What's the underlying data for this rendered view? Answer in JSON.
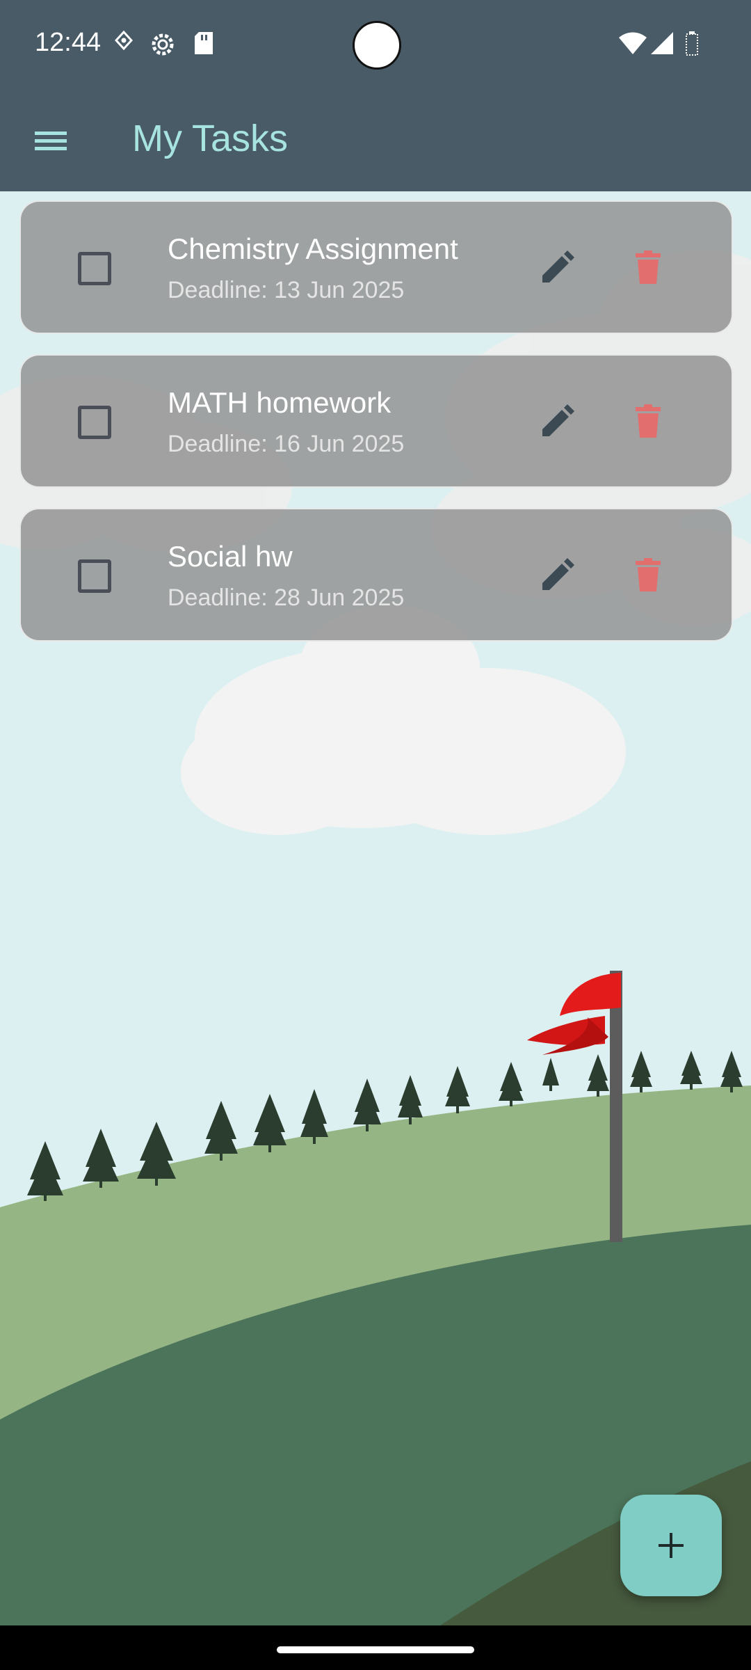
{
  "status_bar": {
    "time": "12:44",
    "icons": [
      "location-pin-icon",
      "settings-gear-icon",
      "sd-card-icon",
      "wifi-icon",
      "cellular-signal-icon",
      "battery-icon"
    ]
  },
  "app_bar": {
    "title": "My Tasks",
    "menu_icon": "hamburger-menu-icon"
  },
  "tasks": [
    {
      "title": "Chemistry Assignment",
      "deadline": "Deadline: 13 Jun 2025",
      "completed": false
    },
    {
      "title": "MATH homework",
      "deadline": "Deadline: 16 Jun 2025",
      "completed": false
    },
    {
      "title": "Social hw",
      "deadline": "Deadline: 28 Jun 2025",
      "completed": false
    }
  ],
  "actions": {
    "edit_icon": "pencil-icon",
    "delete_icon": "trash-icon",
    "add_icon": "plus-icon"
  },
  "colors": {
    "app_bar": "#485b67",
    "title": "#a7e3df",
    "sky": "#dcf0f1",
    "fab": "#7fcdc4",
    "delete": "#e26e6e",
    "flag": "#e31b1b"
  }
}
